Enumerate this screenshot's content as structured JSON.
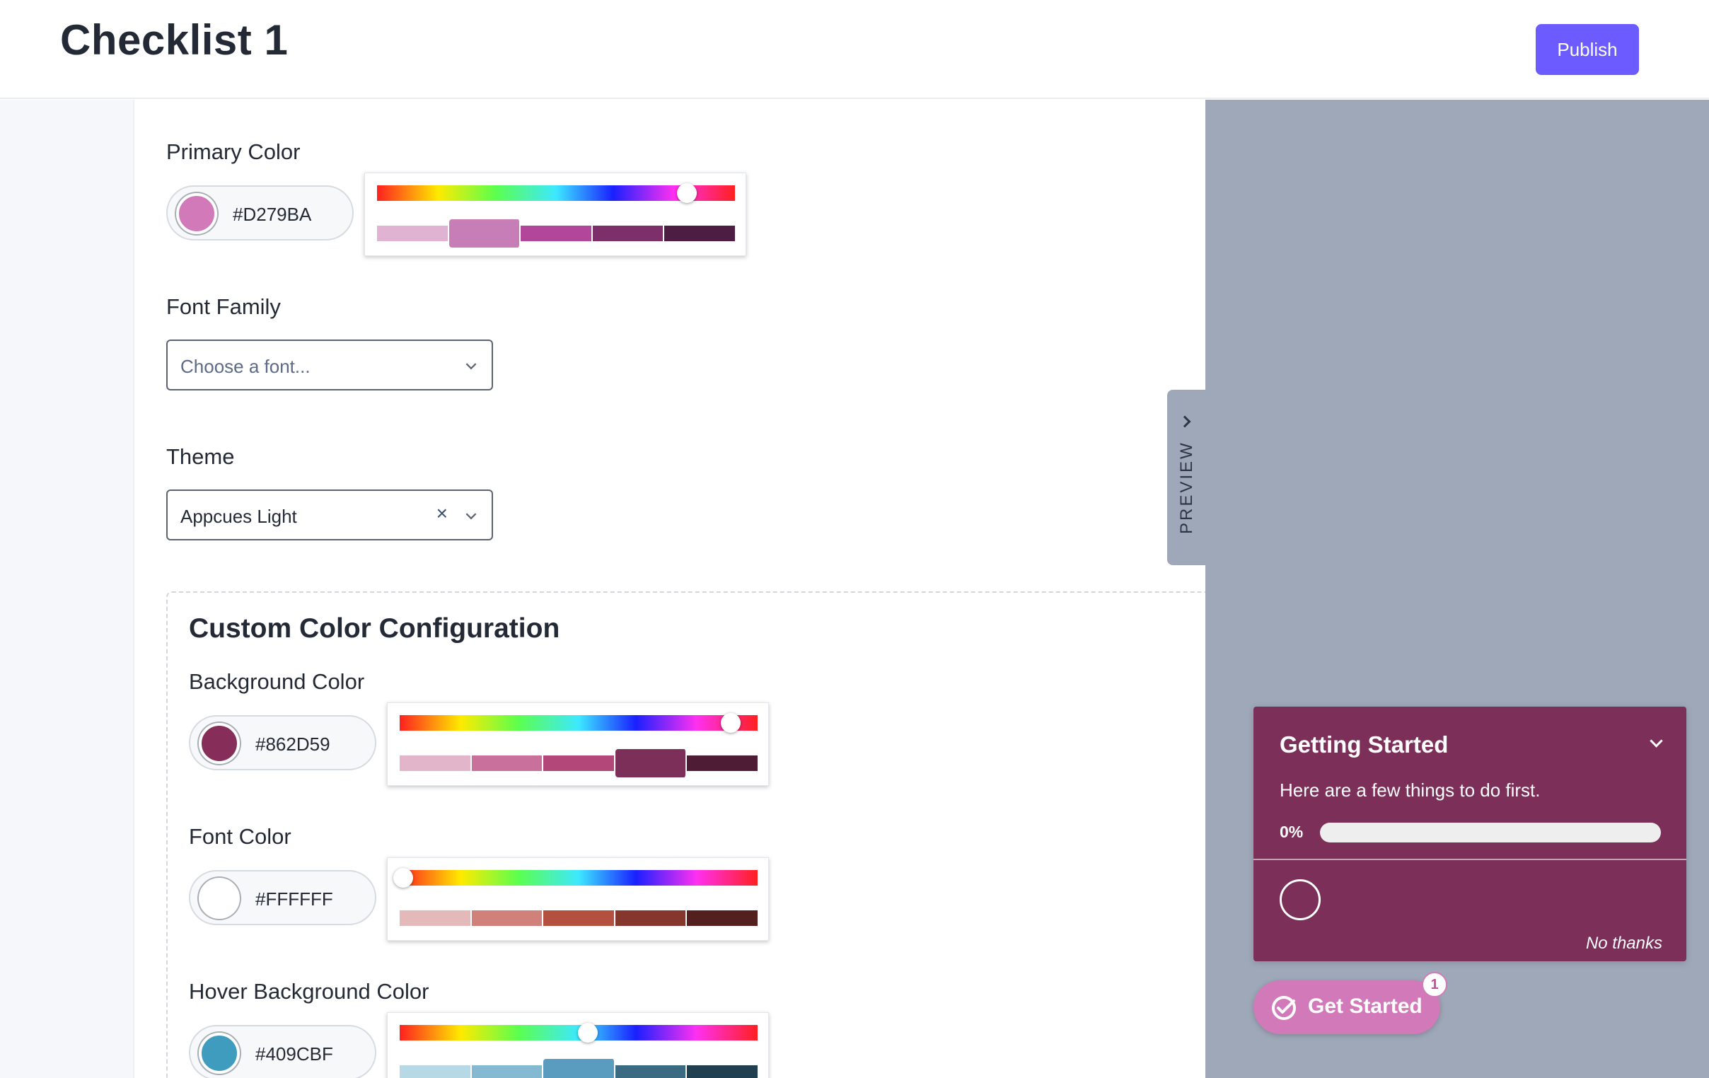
{
  "header": {
    "title": "Checklist 1",
    "publish_label": "Publish"
  },
  "primary_color": {
    "label": "Primary Color",
    "hex": "#D279BA",
    "hue_position": 0.85,
    "shades": [
      "#e1b3d3",
      "#c77db5",
      "#b2469a",
      "#7d2f6a",
      "#4e1d44"
    ],
    "selected_shade": 1
  },
  "font_family": {
    "label": "Font Family",
    "placeholder": "Choose a font..."
  },
  "theme": {
    "label": "Theme",
    "value": "Appcues Light",
    "clear_label": "×"
  },
  "custom_colors": {
    "title": "Custom Color Configuration",
    "background": {
      "label": "Background Color",
      "hex": "#862D59",
      "swatch": "#862D59",
      "hue_position": 0.92,
      "shades": [
        "#e2b5cb",
        "#c9709d",
        "#b34779",
        "#7c2f58",
        "#4f1c36"
      ],
      "selected_shade": 3
    },
    "font": {
      "label": "Font Color",
      "hex": "#FFFFFF",
      "swatch": "#FFFFFF",
      "hue_position": 0.0,
      "shades": [
        "#e4b9b9",
        "#d0817a",
        "#b3503f",
        "#85372e",
        "#531f1f"
      ],
      "selected_shade": -1
    },
    "hover_background": {
      "label": "Hover Background Color",
      "hex": "#409CBF",
      "swatch": "#409CBF",
      "hue_position": 0.53,
      "shades": [
        "#b7d8e5",
        "#85b9d2",
        "#5a9cc0",
        "#3b6b82",
        "#20404f"
      ],
      "selected_shade": 2
    }
  },
  "preview_tab": {
    "label": "PREVIEW"
  },
  "widget": {
    "title": "Getting Started",
    "subtitle": "Here are a few things to do first.",
    "progress_label": "0%",
    "progress": 0.0,
    "no_thanks": "No thanks",
    "background": "#7C2F58"
  },
  "launcher": {
    "label": "Get Started",
    "badge": "1",
    "background": "#D279BA"
  },
  "colors": {
    "accent": "#6C5CFF",
    "preview_bg": "#9EA8B8"
  }
}
